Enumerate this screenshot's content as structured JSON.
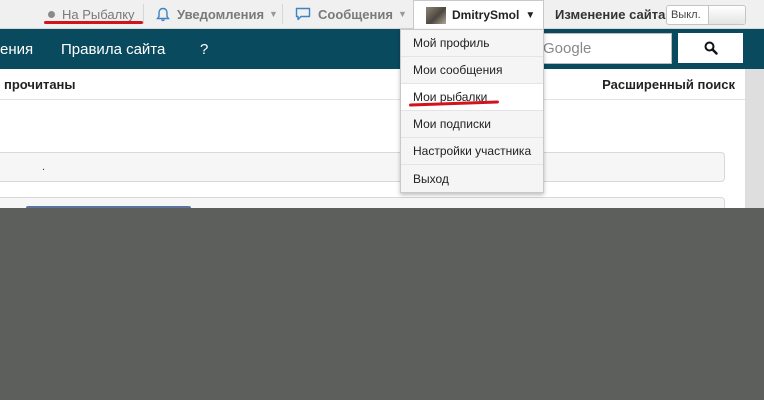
{
  "topbar": {
    "home_label": "На Рыбалку",
    "alerts_label": "Уведомления",
    "messages_label": "Сообщения",
    "user_name": "DmitrySmol",
    "site_edit_label": "Изменение сайта:",
    "toggle_state": "Выкл."
  },
  "nav": {
    "links": [
      {
        "label": "ения"
      },
      {
        "label": "Правила сайта"
      },
      {
        "label": "?"
      }
    ],
    "search_placeholder": "Google"
  },
  "subbar": {
    "left_text": "прочитаны",
    "right_text": "Расширенный поиск"
  },
  "content": {
    "box1_text": "."
  },
  "user_menu": {
    "items": [
      {
        "label": "Мой профиль"
      },
      {
        "label": "Мои сообщения"
      },
      {
        "label": "Мои рыбалки"
      },
      {
        "label": "Мои подписки"
      },
      {
        "label": "Настройки участника"
      },
      {
        "label": "Выход"
      }
    ]
  },
  "colors": {
    "nav_bg": "#0a4a5f",
    "annotation_red": "#d1141b",
    "overlay": "#5c5f5b"
  }
}
